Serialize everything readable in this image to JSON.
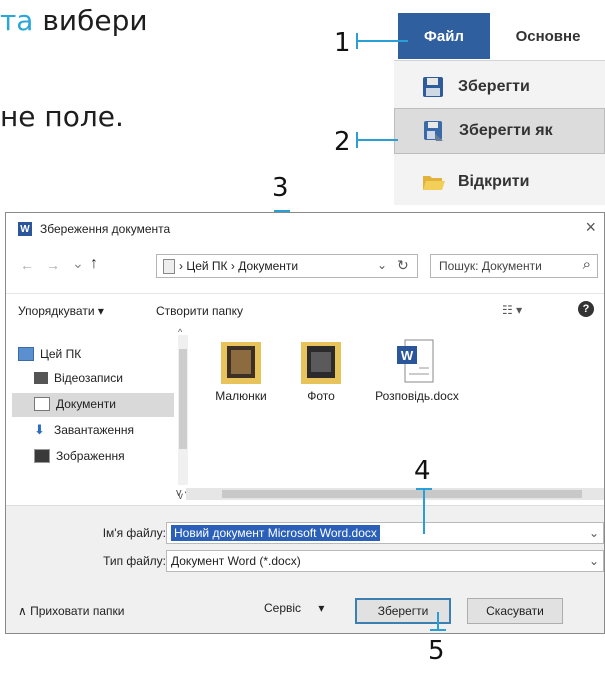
{
  "prose": {
    "line1_highlight": "та",
    "line1_rest": "вибери",
    "line2": "не поле."
  },
  "callouts": [
    "1",
    "2",
    "3",
    "4",
    "5"
  ],
  "ribbon": {
    "tabs": [
      "Файл",
      "Основне"
    ],
    "menu_items": [
      "Зберегти",
      "Зберегти як",
      "Відкрити"
    ]
  },
  "dialog": {
    "title": "Збереження документа",
    "close_glyph": "×",
    "nav_buttons": [
      "←",
      "→",
      "⌄",
      "↑"
    ],
    "address_path": "›  Цей ПК  ›  Документи",
    "refresh_glyph": "↻",
    "search_placeholder": "Пошук: Документи",
    "search_glyph": "⌕",
    "toolbar": {
      "organize": "Упорядкувати ▾",
      "new_folder": "Створити папку",
      "view": "☷ ▾",
      "help": "?"
    },
    "nav_pane": [
      "Цей ПК",
      "Відеозаписи",
      "Документи",
      "Завантаження",
      "Зображення"
    ],
    "files": [
      "Малюнки",
      "Фото",
      "Розповідь.docx"
    ],
    "filename_label": "Ім'я файлу:",
    "filename_value": "Новий документ Microsoft Word.docx",
    "filetype_label": "Тип файлу:",
    "filetype_value": "Документ Word (*.docx)",
    "hide_folders": "∧  Приховати папки",
    "service": "Сервіс",
    "service_arrow": "▾",
    "save_button": "Зберегти",
    "cancel_button": "Скасувати"
  },
  "colors": {
    "accent": "#2a9fd6",
    "file_tab": "#2f5f9e",
    "selection": "#2b60b8"
  }
}
